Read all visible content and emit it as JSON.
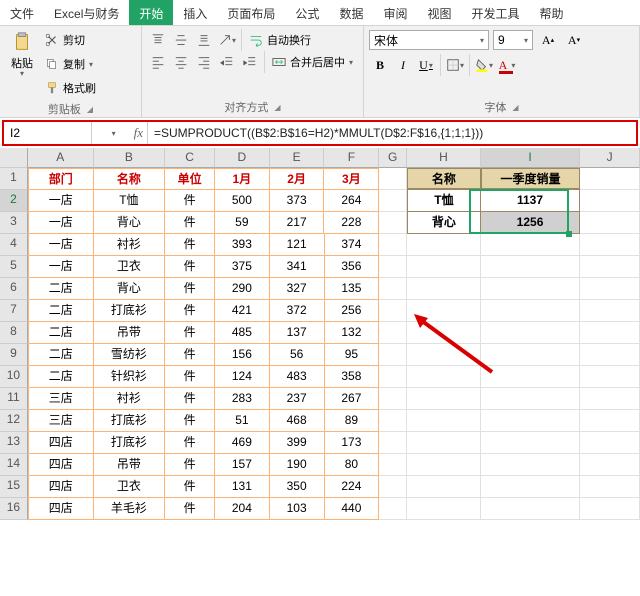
{
  "menu": [
    "文件",
    "Excel与财务",
    "开始",
    "插入",
    "页面布局",
    "公式",
    "数据",
    "审阅",
    "视图",
    "开发工具",
    "帮助"
  ],
  "menu_active_index": 2,
  "ribbon": {
    "clip": {
      "paste": "粘贴",
      "cut": "剪切",
      "copy": "复制",
      "format_painter": "格式刷",
      "group": "剪贴板"
    },
    "align": {
      "wrap": "自动换行",
      "merge": "合并后居中",
      "group": "对齐方式"
    },
    "font": {
      "name": "宋体",
      "size": "9",
      "group": "字体"
    }
  },
  "namebox": "I2",
  "formula": "=SUMPRODUCT((B$2:B$16=H2)*MMULT(D$2:F$16,{1;1;1}))",
  "cols": [
    "",
    "A",
    "B",
    "C",
    "D",
    "E",
    "F",
    "G",
    "H",
    "I",
    "J"
  ],
  "main_headers": [
    "部门",
    "名称",
    "单位",
    "1月",
    "2月",
    "3月"
  ],
  "side_headers": [
    "名称",
    "一季度销量"
  ],
  "rows": [
    [
      "一店",
      "T恤",
      "件",
      "500",
      "373",
      "264"
    ],
    [
      "一店",
      "背心",
      "件",
      "59",
      "217",
      "228"
    ],
    [
      "一店",
      "衬衫",
      "件",
      "393",
      "121",
      "374"
    ],
    [
      "一店",
      "卫衣",
      "件",
      "375",
      "341",
      "356"
    ],
    [
      "二店",
      "背心",
      "件",
      "290",
      "327",
      "135"
    ],
    [
      "二店",
      "打底衫",
      "件",
      "421",
      "372",
      "256"
    ],
    [
      "二店",
      "吊带",
      "件",
      "485",
      "137",
      "132"
    ],
    [
      "二店",
      "雪纺衫",
      "件",
      "156",
      "56",
      "95"
    ],
    [
      "二店",
      "针织衫",
      "件",
      "124",
      "483",
      "358"
    ],
    [
      "三店",
      "衬衫",
      "件",
      "283",
      "237",
      "267"
    ],
    [
      "三店",
      "打底衫",
      "件",
      "51",
      "468",
      "89"
    ],
    [
      "四店",
      "打底衫",
      "件",
      "469",
      "399",
      "173"
    ],
    [
      "四店",
      "吊带",
      "件",
      "157",
      "190",
      "80"
    ],
    [
      "四店",
      "卫衣",
      "件",
      "131",
      "350",
      "224"
    ],
    [
      "四店",
      "羊毛衫",
      "件",
      "204",
      "103",
      "440"
    ]
  ],
  "side_rows": [
    [
      "T恤",
      "1137"
    ],
    [
      "背心",
      "1256"
    ]
  ]
}
